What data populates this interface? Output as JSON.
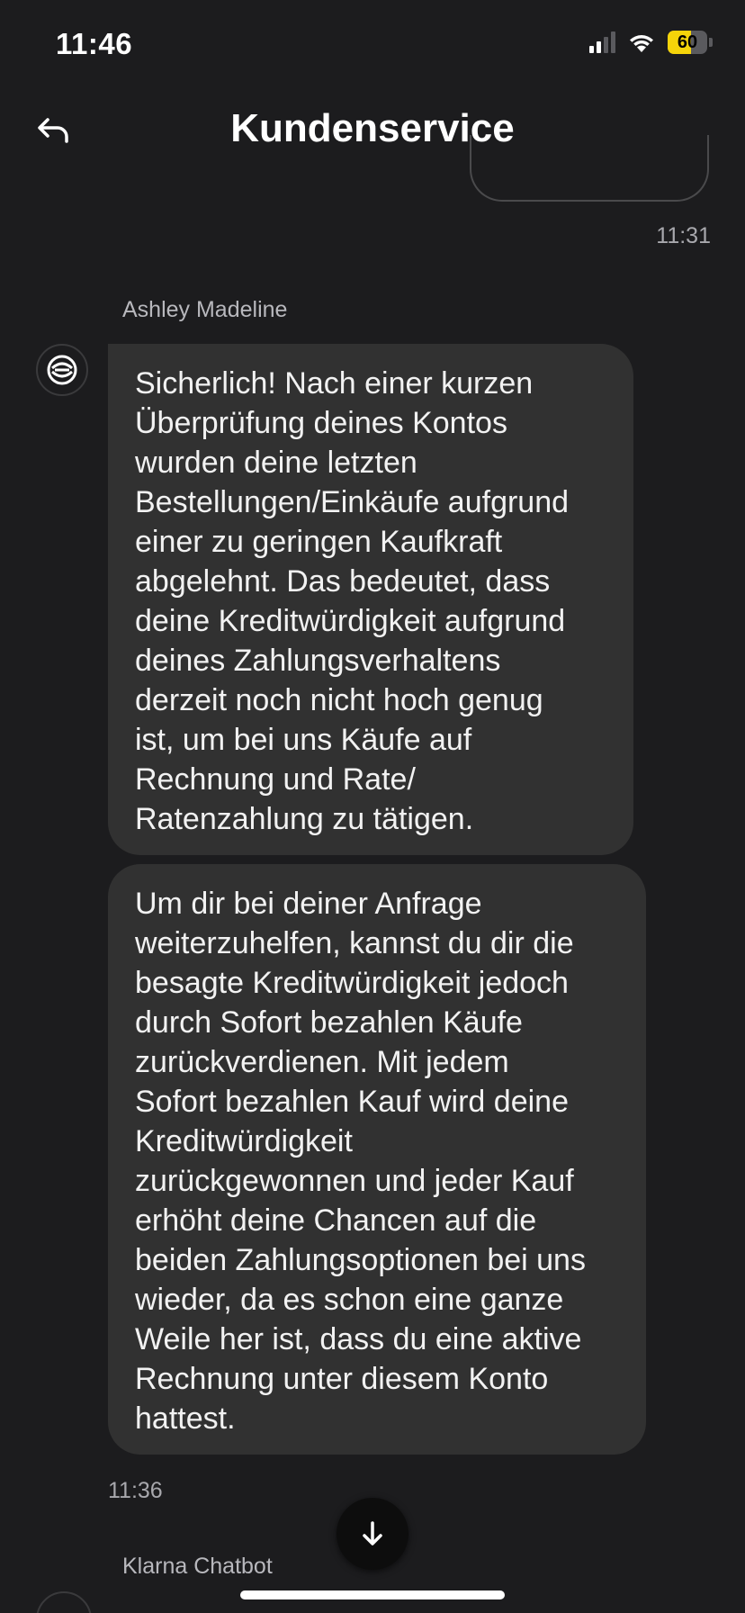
{
  "status_bar": {
    "time": "11:46",
    "battery_level": "60",
    "battery_fraction": 0.6,
    "signal_bars_active": 2,
    "signal_bars_total": 4
  },
  "header": {
    "title": "Kundenservice",
    "back_icon": "reply-arrow-icon"
  },
  "previous_message": {
    "timestamp": "11:31"
  },
  "agent_group": {
    "sender": "Ashley Madeline",
    "avatar_icon": "klarna-face-icon",
    "messages": [
      {
        "lines": [
          "Sicherlich! Nach einer kurzen",
          "Überprüfung deines Kontos",
          "wurden deine letzten",
          "Bestellungen/Einkäufe aufgrund",
          "einer zu geringen Kaufkraft",
          "abgelehnt. Das bedeutet, dass",
          "deine Kreditwürdigkeit aufgrund",
          "deines Zahlungsverhaltens",
          "derzeit noch nicht hoch genug",
          "ist, um bei uns Käufe auf",
          "Rechnung und Rate/",
          "Ratenzahlung zu tätigen."
        ]
      },
      {
        "lines": [
          "Um dir bei deiner Anfrage",
          "weiterzuhelfen, kannst du dir die",
          "besagte Kreditwürdigkeit jedoch",
          "durch Sofort bezahlen Käufe",
          "zurückverdienen. Mit jedem",
          "Sofort bezahlen Kauf wird deine",
          "Kreditwürdigkeit",
          "zurückgewonnen und jeder Kauf",
          "erhöht deine Chancen auf die",
          "beiden Zahlungsoptionen bei uns",
          "wieder, da es schon eine ganze",
          "Weile her ist, dass du eine aktive",
          "Rechnung unter diesem Konto",
          "hattest."
        ]
      }
    ],
    "timestamp": "11:36"
  },
  "next_group": {
    "sender": "Klarna Chatbot"
  },
  "scroll_down_icon": "arrow-down-icon"
}
